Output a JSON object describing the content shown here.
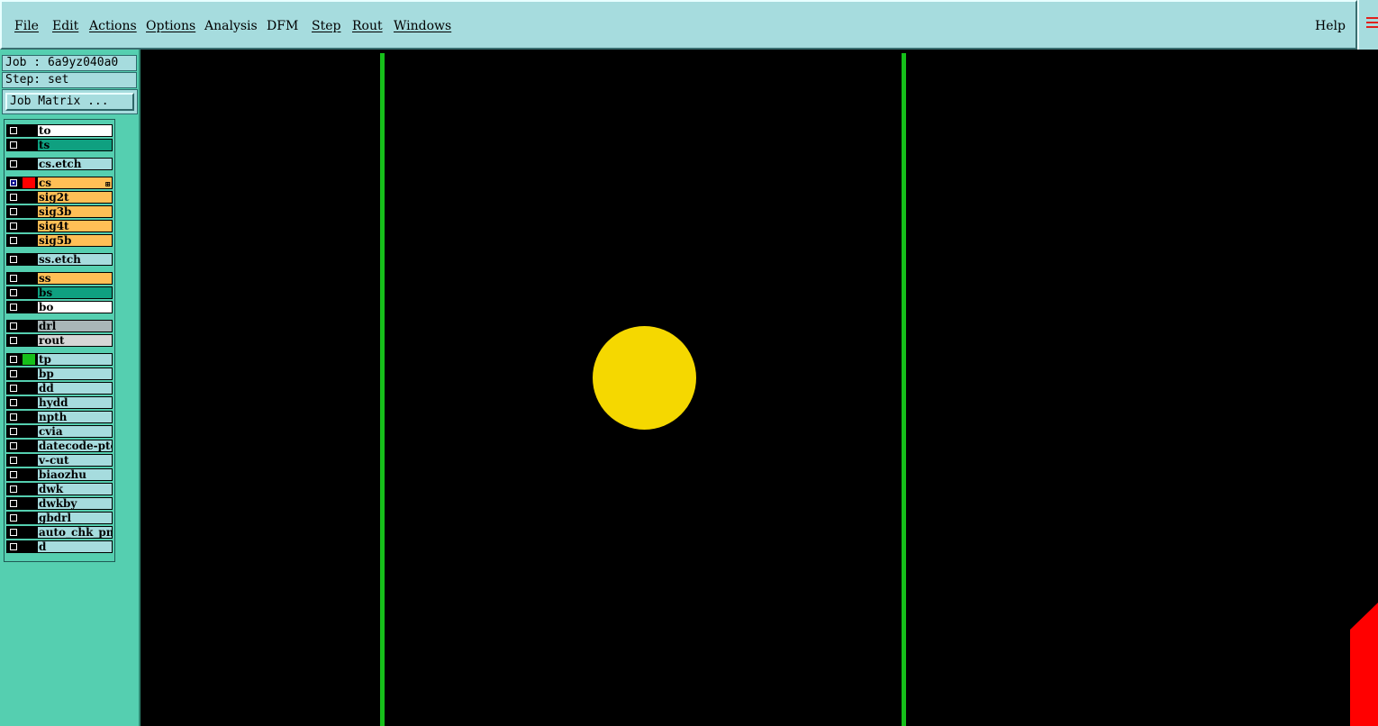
{
  "menubar": {
    "items": [
      {
        "label": "File"
      },
      {
        "label": "Edit"
      },
      {
        "label": "Actions"
      },
      {
        "label": "Options"
      },
      {
        "label": "Analysis"
      },
      {
        "label": "DFM"
      },
      {
        "label": "Step"
      },
      {
        "label": "Rout"
      },
      {
        "label": "Windows"
      }
    ],
    "help": "Help"
  },
  "panel": {
    "job": "Job : 6a9yz040a0",
    "step": "Step: set",
    "job_matrix_button": "Job Matrix ..."
  },
  "layers": [
    {
      "name": "to",
      "color": "#ffffff"
    },
    {
      "name": "ts",
      "color": "#0fa080"
    },
    {
      "name": "cs.etch",
      "color": "#a6dcde"
    },
    {
      "name": "cs",
      "color": "#ffbf56",
      "selected": true,
      "display_color": "#ff0000"
    },
    {
      "name": "sig2t",
      "color": "#ffbf56"
    },
    {
      "name": "sig3b",
      "color": "#ffbf56"
    },
    {
      "name": "sig4t",
      "color": "#ffbf56"
    },
    {
      "name": "sig5b",
      "color": "#ffbf56"
    },
    {
      "name": "ss.etch",
      "color": "#a6dcde"
    },
    {
      "name": "ss",
      "color": "#ffbf56"
    },
    {
      "name": "bs",
      "color": "#0fa080"
    },
    {
      "name": "bo",
      "color": "#ffffff"
    },
    {
      "name": "drl",
      "color": "#a9b6b8"
    },
    {
      "name": "rout",
      "color": "#d6d6d6"
    },
    {
      "name": "tp",
      "color": "#a6dcde",
      "display_color": "#16c01a"
    },
    {
      "name": "bp",
      "color": "#a6dcde"
    },
    {
      "name": "dd",
      "color": "#a6dcde"
    },
    {
      "name": "hydd",
      "color": "#a6dcde"
    },
    {
      "name": "npth",
      "color": "#a6dcde"
    },
    {
      "name": "cvia",
      "color": "#a6dcde"
    },
    {
      "name": "datecode-pte",
      "color": "#a6dcde"
    },
    {
      "name": "v-cut",
      "color": "#a6dcde"
    },
    {
      "name": "biaozhu",
      "color": "#a6dcde"
    },
    {
      "name": "dwk",
      "color": "#a6dcde"
    },
    {
      "name": "dwkby",
      "color": "#a6dcde"
    },
    {
      "name": "gbdrl",
      "color": "#a6dcde"
    },
    {
      "name": "auto_chk_pnl",
      "color": "#a6dcde"
    },
    {
      "name": "d",
      "color": "#a6dcde"
    }
  ],
  "canvas": {
    "background": "#000000",
    "trace_color": "#16c01a",
    "pad_color": "#f5d800",
    "highlight_color": "#ff0000"
  }
}
